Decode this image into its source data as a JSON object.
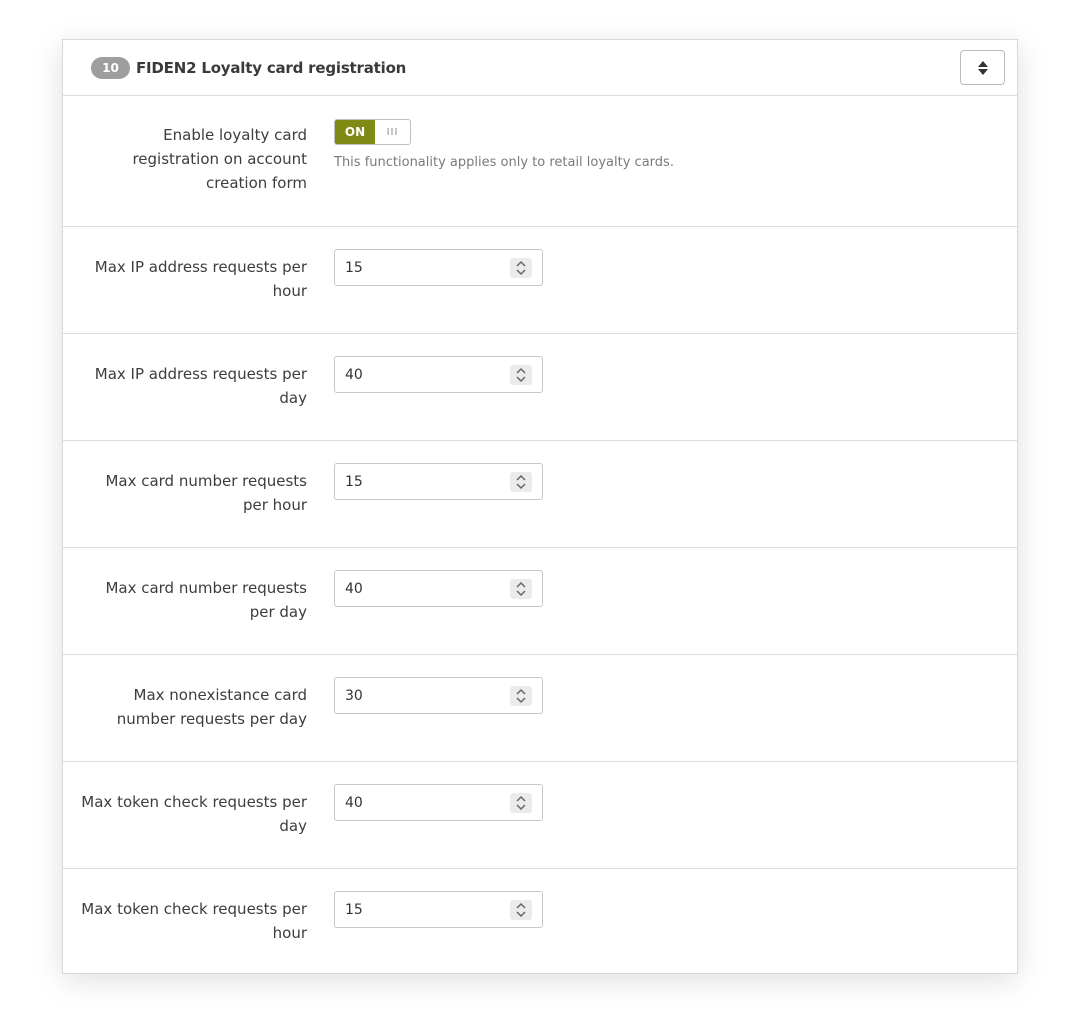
{
  "panel": {
    "badge": "10",
    "title": "FIDEN2 Loyalty card registration"
  },
  "toggle_field": {
    "label": "Enable loyalty card registration on account creation form",
    "state_label": "ON",
    "handle_glyph": "III",
    "help_text": "This functionality applies only to retail loyalty cards."
  },
  "fields": [
    {
      "label": "Max IP address requests per hour",
      "value": "15"
    },
    {
      "label": "Max IP address requests per day",
      "value": "40"
    },
    {
      "label": "Max card number requests per hour",
      "value": "15"
    },
    {
      "label": "Max card number requests per day",
      "value": "40"
    },
    {
      "label": "Max nonexistance card number requests per day",
      "value": "30"
    },
    {
      "label": "Max token check requests per day",
      "value": "40"
    },
    {
      "label": "Max token check requests per hour",
      "value": "15"
    }
  ],
  "icons": {
    "sort": "sort-icon",
    "spinner": "spinner-icon"
  },
  "colors": {
    "toggle_on": "#7e8a13",
    "badge": "#9e9e9e"
  }
}
